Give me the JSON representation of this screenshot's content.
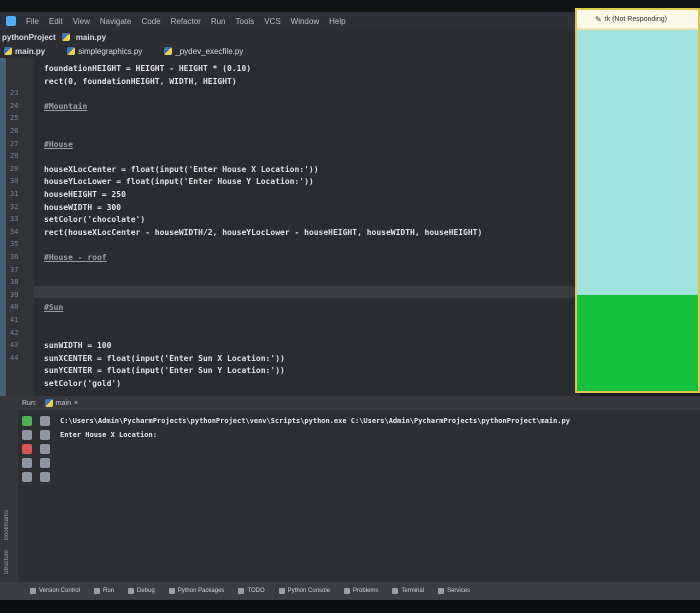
{
  "menu": [
    "File",
    "Edit",
    "View",
    "Navigate",
    "Code",
    "Refactor",
    "Run",
    "Tools",
    "VCS",
    "Window",
    "Help"
  ],
  "breadcrumb": {
    "project": "pythonProject",
    "file": "main.py"
  },
  "tabs": [
    {
      "label": "main.py",
      "active": true
    },
    {
      "label": "simplegraphics.py",
      "active": false
    },
    {
      "label": "_pydev_execfile.py",
      "active": false
    }
  ],
  "turtle_window": {
    "title": "tk (Not Responding)",
    "colors": {
      "sky": "#9fe2de",
      "grass": "#15c13c"
    }
  },
  "editor": {
    "lines": [
      {
        "n": "",
        "t": "foundationHEIGHT = HEIGHT - HEIGHT * (0.10)"
      },
      {
        "n": "",
        "t": "rect(0, foundationHEIGHT, WIDTH, HEIGHT)"
      },
      {
        "n": "23",
        "t": ""
      },
      {
        "n": "24",
        "t": "#Mountain",
        "c": "comment"
      },
      {
        "n": "25",
        "t": ""
      },
      {
        "n": "26",
        "t": ""
      },
      {
        "n": "27",
        "t": "#House",
        "c": "comment"
      },
      {
        "n": "28",
        "t": ""
      },
      {
        "n": "29",
        "t": "houseXLocCenter = float(input('Enter House X Location:'))"
      },
      {
        "n": "30",
        "t": "houseYLocLower = float(input('Enter House Y Location:'))"
      },
      {
        "n": "31",
        "t": "houseHEIGHT = 250"
      },
      {
        "n": "32",
        "t": "houseWIDTH = 300"
      },
      {
        "n": "33",
        "t": "setColor('chocolate')"
      },
      {
        "n": "34",
        "t": "rect(houseXLocCenter - houseWIDTH/2, houseYLocLower - houseHEIGHT, houseWIDTH, houseHEIGHT)"
      },
      {
        "n": "35",
        "t": ""
      },
      {
        "n": "36",
        "t": "#House - roof",
        "c": "comment"
      },
      {
        "n": "37",
        "t": ""
      },
      {
        "n": "38",
        "t": ""
      },
      {
        "n": "39",
        "t": ""
      },
      {
        "n": "40",
        "t": "#Sun",
        "c": "comment"
      },
      {
        "n": "41",
        "t": ""
      },
      {
        "n": "42",
        "t": ""
      },
      {
        "n": "43",
        "t": "sunWIDTH = 100"
      },
      {
        "n": "44",
        "t": "sunXCENTER = float(input('Enter Sun X Location:'))"
      },
      {
        "n": "",
        "t": "sunYCENTER = float(input('Enter Sun Y Location:'))"
      },
      {
        "n": "",
        "t": "setColor('gold')"
      }
    ]
  },
  "run": {
    "label": "Run:",
    "tab": "main",
    "console": [
      "C:\\Users\\Admin\\PycharmProjects\\pythonProject\\venv\\Scripts\\python.exe C:\\Users\\Admin\\PycharmProjects\\pythonProject\\main.py",
      "Enter House X Location:"
    ]
  },
  "side_labels": {
    "bookmarks": "Bookmarks",
    "structure": "Structure"
  },
  "statusbar": [
    "Version Control",
    "Run",
    "Debug",
    "Python Packages",
    "TODO",
    "Python Console",
    "Problems",
    "Terminal",
    "Services"
  ]
}
